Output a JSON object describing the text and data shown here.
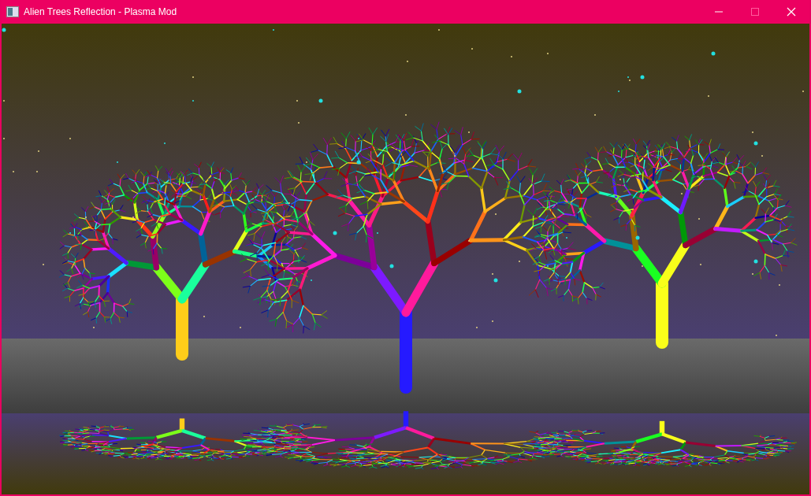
{
  "window": {
    "title": "Alien Trees Reflection - Plasma Mod"
  },
  "controls": [
    {
      "kind": "minimize",
      "disabled": false
    },
    {
      "kind": "maximize",
      "disabled": true
    },
    {
      "kind": "close",
      "disabled": false
    }
  ]
}
